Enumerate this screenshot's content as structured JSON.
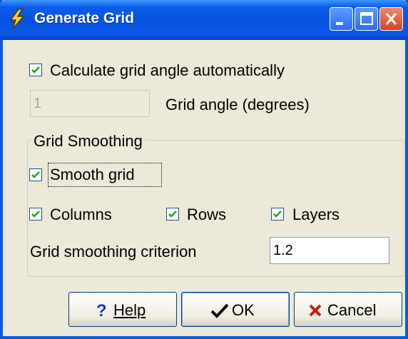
{
  "window": {
    "title": "Generate Grid"
  },
  "auto_angle": {
    "label": "Calculate grid angle automatically",
    "checked": true
  },
  "grid_angle": {
    "value": "1",
    "label": "Grid angle (degrees)",
    "disabled": true
  },
  "smoothing": {
    "group_title": "Grid Smoothing",
    "smooth_grid": {
      "label": "Smooth grid",
      "checked": true
    },
    "columns": {
      "label": "Columns",
      "checked": true
    },
    "rows": {
      "label": "Rows",
      "checked": true
    },
    "layers": {
      "label": "Layers",
      "checked": true
    },
    "criterion_label": "Grid smoothing criterion",
    "criterion_value": "1.2"
  },
  "buttons": {
    "help": "Help",
    "ok": "OK",
    "cancel": "Cancel"
  },
  "icons": [
    "lightning-icon",
    "minimize-icon",
    "maximize-icon",
    "close-icon",
    "question-icon",
    "checkmark-icon",
    "x-icon"
  ]
}
